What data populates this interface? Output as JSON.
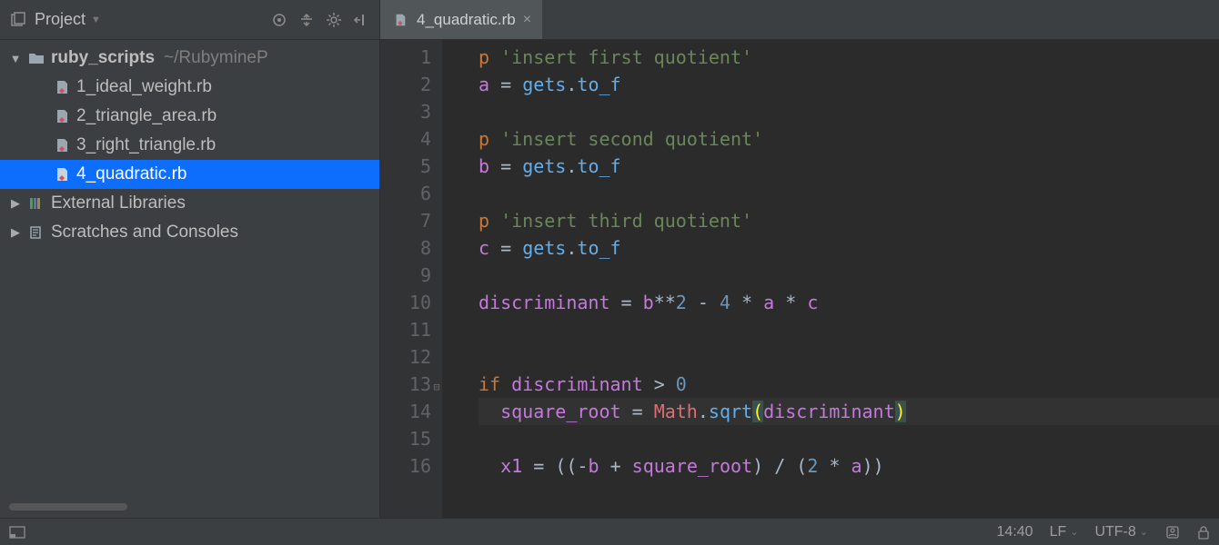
{
  "panel": {
    "title": "Project",
    "icons": {
      "target": "target-icon",
      "collapse": "collapse-icon",
      "gear": "gear-icon",
      "hide": "hide-icon"
    }
  },
  "tree": {
    "root": {
      "name": "ruby_scripts",
      "path": "~/RubymineP"
    },
    "files": [
      "1_ideal_weight.rb",
      "2_triangle_area.rb",
      "3_right_triangle.rb",
      "4_quadratic.rb"
    ],
    "selectedIndex": 3,
    "externalLibs": "External Libraries",
    "scratches": "Scratches and Consoles"
  },
  "tab": {
    "name": "4_quadratic.rb"
  },
  "code": {
    "lines": [
      "p 'insert first quotient'",
      "a = gets.to_f",
      "",
      "p 'insert second quotient'",
      "b = gets.to_f",
      "",
      "p 'insert third quotient'",
      "c = gets.to_f",
      "",
      "discriminant = b**2 - 4 * a * c",
      "",
      "",
      "if discriminant > 0",
      "  square_root = Math.sqrt(discriminant)",
      "",
      "  x1 = ((-b + square_root) / (2 * a))"
    ]
  },
  "status": {
    "position": "14:40",
    "lineSep": "LF",
    "encoding": "UTF-8"
  }
}
